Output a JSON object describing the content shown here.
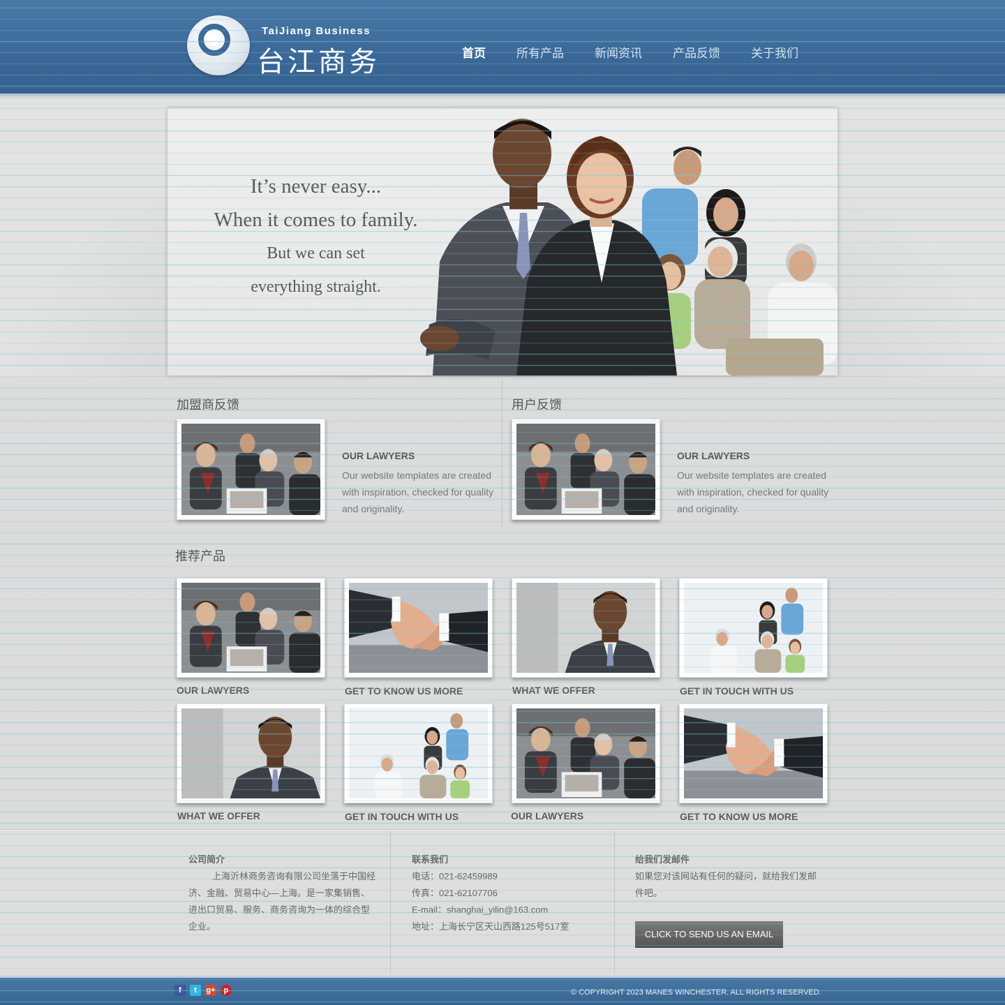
{
  "header": {
    "logo_en": "TaiJiang  Business",
    "logo_cn": "台江商务",
    "nav": [
      {
        "label": "首页",
        "active": true
      },
      {
        "label": "所有产品",
        "active": false
      },
      {
        "label": "新闻资讯",
        "active": false
      },
      {
        "label": "产品反馈",
        "active": false
      },
      {
        "label": "关于我们",
        "active": false
      }
    ]
  },
  "banner": {
    "line1": "It’s never easy...",
    "line2": "When it comes to family.",
    "line3": "But we can set",
    "line4": "everything straight."
  },
  "feedback": [
    {
      "title": "加盟商反馈",
      "heading": "OUR LAWYERS",
      "body": "Our website templates are created with inspiration, checked for quality  and originality.",
      "image": "business-meeting"
    },
    {
      "title": "用户反馈",
      "heading": "OUR LAWYERS",
      "body": "Our website templates are created with inspiration, checked for quality  and originality.",
      "image": "business-meeting"
    }
  ],
  "products": {
    "title": "推荐产品",
    "items": [
      {
        "label": "OUR LAWYERS",
        "image": "business-meeting"
      },
      {
        "label": "GET TO KNOW US MORE",
        "image": "handshake"
      },
      {
        "label": "WHAT WE OFFER",
        "image": "businessman"
      },
      {
        "label": "GET IN TOUCH WITH US",
        "image": "family"
      },
      {
        "label": "WHAT WE OFFER",
        "image": "businessman"
      },
      {
        "label": "GET IN TOUCH WITH US",
        "image": "family"
      },
      {
        "label": "OUR LAWYERS",
        "image": "business-meeting"
      },
      {
        "label": "GET TO KNOW US MORE",
        "image": "handshake"
      }
    ]
  },
  "footer": {
    "about": {
      "title": "公司简介",
      "body": "上海沂林商务咨询有限公司坐落于中国经济、金融、贸易中心—上海。是一家集销售、进出口贸易、服务、商务咨询为一体的综合型企业。"
    },
    "contact": {
      "title": "联系我们",
      "phone": "电话：021-62459989",
      "fax": "传真：021-62107706",
      "email": "E-mail：shanghai_yilin@163.com",
      "address": "地址：上海长宁区天山西路125号517室"
    },
    "mail": {
      "title": "给我们发邮件",
      "body": "如果您对该网站有任何的疑问，就给我们发邮件吧。",
      "button": "CLICK TO SEND US AN EMAIL"
    },
    "social": [
      {
        "name": "facebook-icon",
        "glyph": "f"
      },
      {
        "name": "twitter-icon",
        "glyph": "t"
      },
      {
        "name": "google-plus-icon",
        "glyph": "g+"
      },
      {
        "name": "pinterest-icon",
        "glyph": "p"
      }
    ],
    "copyright": "© COPYRIGHT 2023 MANES WINCHESTER. ALL RIGHTS RESERVED."
  },
  "colors": {
    "header_blue": "#3b6898",
    "page_bg": "#dcdcdc",
    "button_gray": "#666666"
  }
}
